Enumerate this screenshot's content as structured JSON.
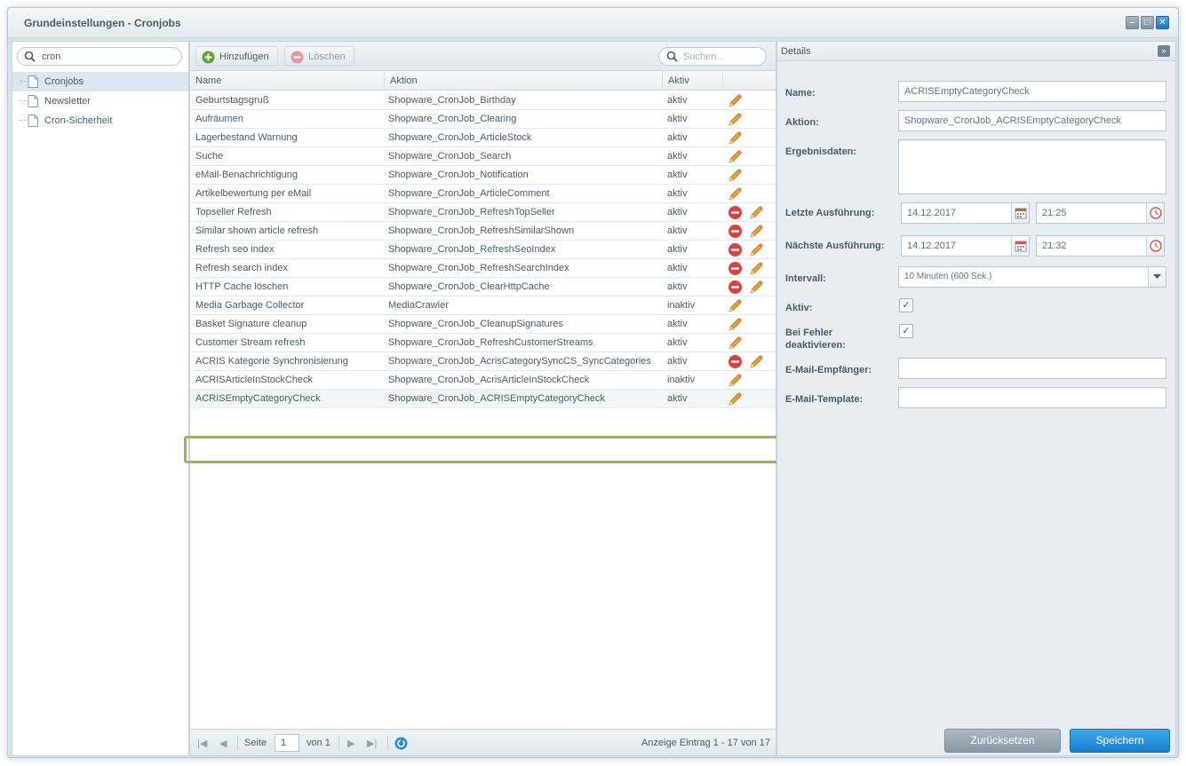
{
  "window": {
    "title": "Grundeinstellungen - Cronjobs"
  },
  "tree": {
    "search_value": "cron",
    "items": [
      {
        "label": "Cronjobs",
        "selected": true
      },
      {
        "label": "Newsletter",
        "selected": false
      },
      {
        "label": "Cron-Sicherheit",
        "selected": false
      }
    ]
  },
  "toolbar": {
    "add_label": "Hinzufügen",
    "delete_label": "Löschen",
    "search_placeholder": "Suchen..."
  },
  "grid": {
    "columns": {
      "name": "Name",
      "action": "Aktion",
      "active": "Aktiv"
    },
    "rows": [
      {
        "name": "Geburtstagsgruß",
        "action": "Shopware_CronJob_Birthday",
        "active": "aktiv",
        "deletable": false
      },
      {
        "name": "Aufräumen",
        "action": "Shopware_CronJob_Clearing",
        "active": "aktiv",
        "deletable": false
      },
      {
        "name": "Lagerbestand Warnung",
        "action": "Shopware_CronJob_ArticleStock",
        "active": "aktiv",
        "deletable": false
      },
      {
        "name": "Suche",
        "action": "Shopware_CronJob_Search",
        "active": "aktiv",
        "deletable": false
      },
      {
        "name": "eMail-Benachrichtigung",
        "action": "Shopware_CronJob_Notification",
        "active": "aktiv",
        "deletable": false
      },
      {
        "name": "Artikelbewertung per eMail",
        "action": "Shopware_CronJob_ArticleComment",
        "active": "aktiv",
        "deletable": false
      },
      {
        "name": "Topseller Refresh",
        "action": "Shopware_CronJob_RefreshTopSeller",
        "active": "aktiv",
        "deletable": true
      },
      {
        "name": "Similar shown article refresh",
        "action": "Shopware_CronJob_RefreshSimilarShown",
        "active": "aktiv",
        "deletable": true
      },
      {
        "name": "Refresh seo index",
        "action": "Shopware_CronJob_RefreshSeoIndex",
        "active": "aktiv",
        "deletable": true
      },
      {
        "name": "Refresh search index",
        "action": "Shopware_CronJob_RefreshSearchIndex",
        "active": "aktiv",
        "deletable": true
      },
      {
        "name": "HTTP Cache löschen",
        "action": "Shopware_CronJob_ClearHttpCache",
        "active": "aktiv",
        "deletable": true
      },
      {
        "name": "Media Garbage Collector",
        "action": "MediaCrawler",
        "active": "inaktiv",
        "deletable": false
      },
      {
        "name": "Basket Signature cleanup",
        "action": "Shopware_CronJob_CleanupSignatures",
        "active": "aktiv",
        "deletable": false
      },
      {
        "name": "Customer Stream refresh",
        "action": "Shopware_CronJob_RefreshCustomerStreams",
        "active": "aktiv",
        "deletable": false
      },
      {
        "name": "ACRIS Kategorie Synchronisierung",
        "action": "Shopware_CronJob_AcrisCategorySyncCS_SyncCategories",
        "active": "aktiv",
        "deletable": true
      },
      {
        "name": "ACRISArticleInStockCheck",
        "action": "Shopware_CronJob_AcrisArticleInStockCheck",
        "active": "inaktiv",
        "deletable": false
      },
      {
        "name": "ACRISEmptyCategoryCheck",
        "action": "Shopware_CronJob_ACRISEmptyCategoryCheck",
        "active": "aktiv",
        "deletable": false,
        "selected": true
      }
    ]
  },
  "pager": {
    "page_label": "Seite",
    "page_value": "1",
    "of_label": "von 1",
    "display": "Anzeige Eintrag 1 - 17 von 17"
  },
  "details": {
    "header": "Details",
    "name_label": "Name:",
    "name_value": "ACRISEmptyCategoryCheck",
    "action_label": "Aktion:",
    "action_value": "Shopware_CronJob_ACRISEmptyCategoryCheck",
    "result_label": "Ergebnisdaten:",
    "result_value": "",
    "last_label": "Letzte Ausführung:",
    "last_date": "14.12.2017",
    "last_time": "21:25",
    "next_label": "Nächste Ausführung:",
    "next_date": "14.12.2017",
    "next_time": "21:32",
    "interval_label": "Intervall:",
    "interval_value": "10 Minuten (600 Sek.)",
    "active_label": "Aktiv:",
    "active_checked": true,
    "deactivate_label_1": "Bei Fehler",
    "deactivate_label_2": "deaktivieren:",
    "deactivate_checked": true,
    "email_label": "E-Mail-Empfänger:",
    "email_value": "",
    "template_label": "E-Mail-Template:",
    "template_value": "",
    "reset_label": "Zurücksetzen",
    "save_label": "Speichern"
  },
  "colors": {
    "accent": "#1f87d8",
    "highlight": "#97bb3a",
    "delete": "#d9403f",
    "pencil": "#e8962a"
  }
}
